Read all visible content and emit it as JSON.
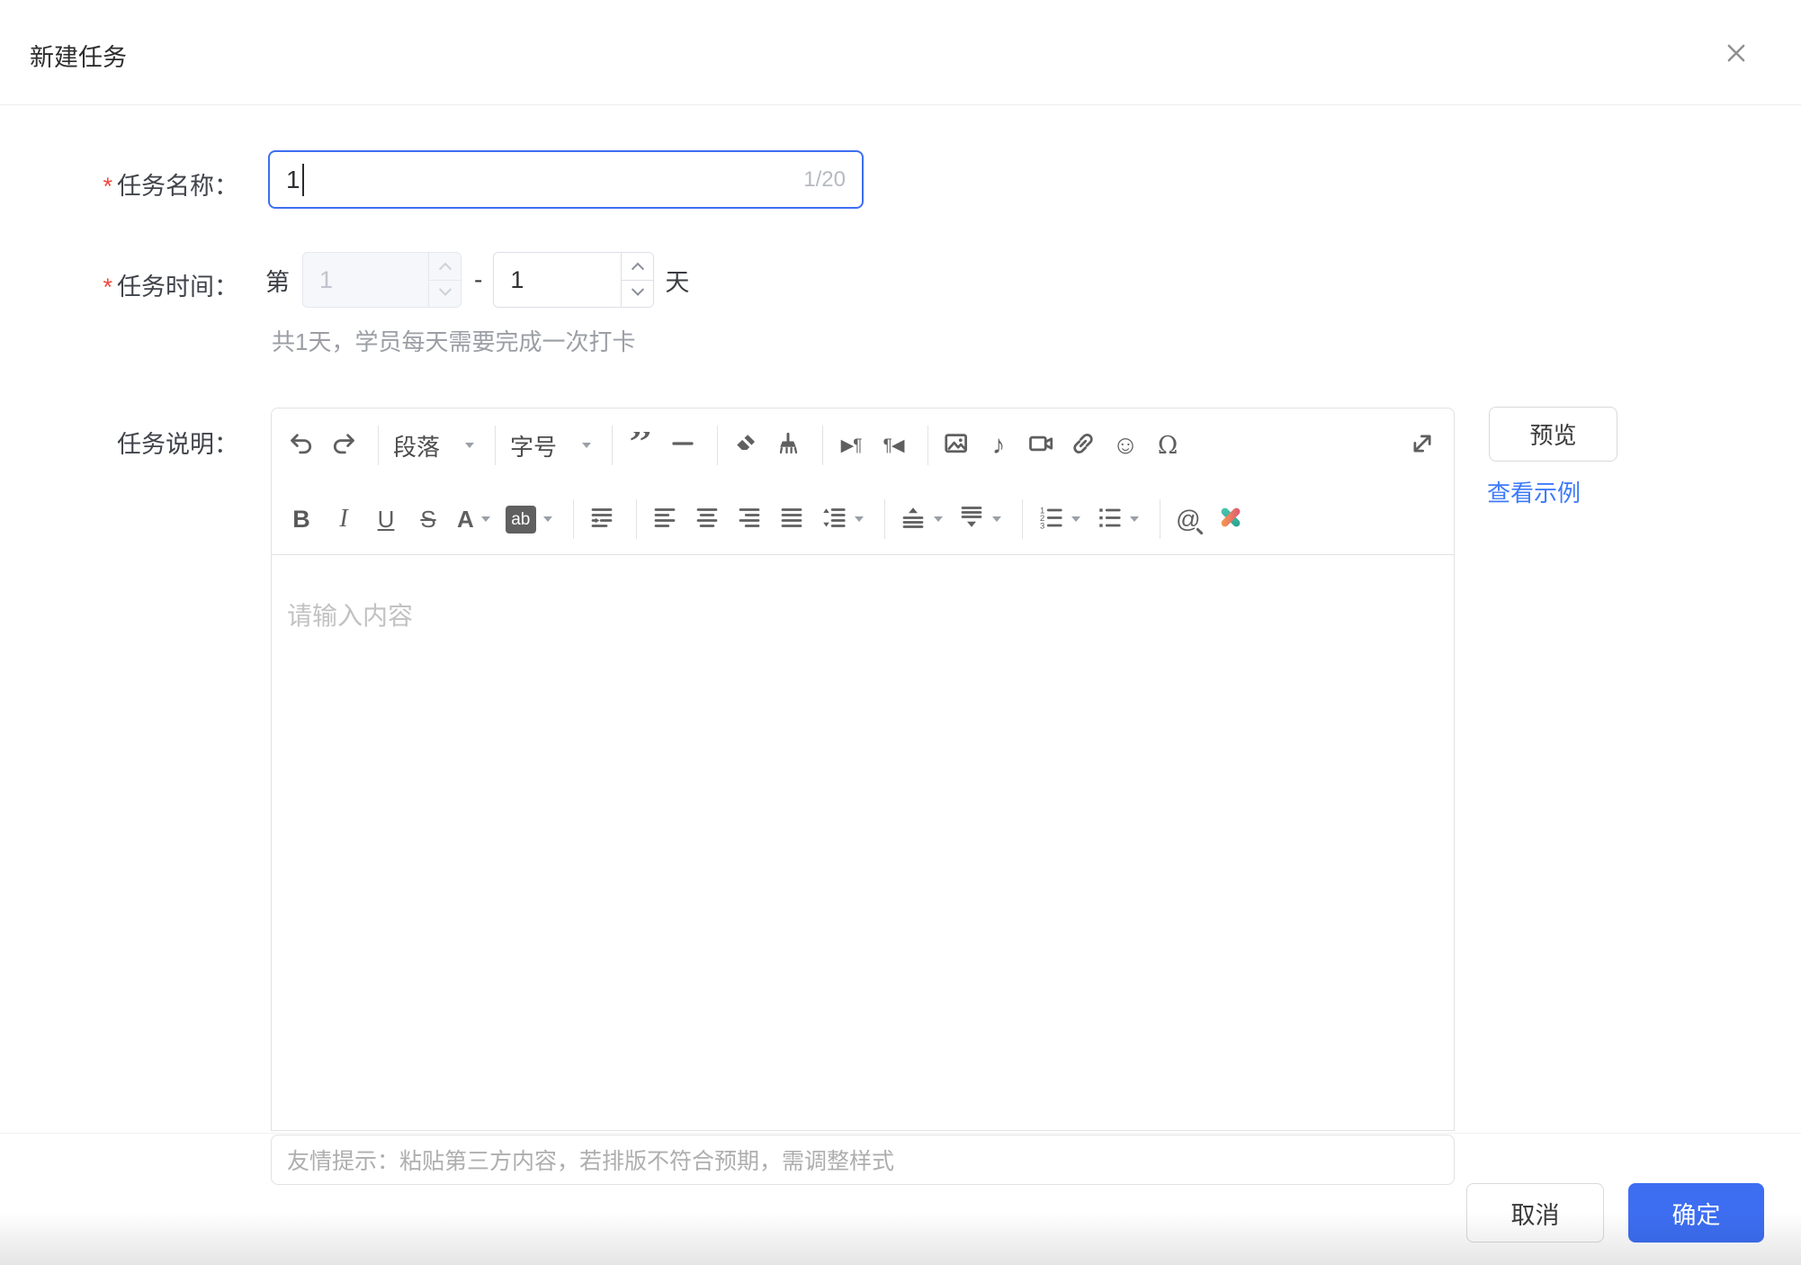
{
  "dialog": {
    "title": "新建任务",
    "close_icon": "x"
  },
  "form": {
    "task_name": {
      "required_mark": "*",
      "label": "任务名称：",
      "value": "1",
      "counter": "1/20"
    },
    "task_time": {
      "required_mark": "*",
      "label": "任务时间：",
      "prefix": "第",
      "start_value": "1",
      "start_disabled": true,
      "dash": "-",
      "end_value": "1",
      "suffix": "天",
      "hint": "共1天，学员每天需要完成一次打卡"
    },
    "task_desc": {
      "label": "任务说明："
    }
  },
  "editor": {
    "placeholder": "请输入内容",
    "paste_tip": "友情提示：粘贴第三方内容，若排版不符合预期，需调整样式",
    "toolbar_rows": [
      [
        "undo",
        "redo",
        "|",
        "paragraph-select",
        "|",
        "font-size-select",
        "|",
        "blockquote",
        "horizontal-rule",
        "|",
        "clear-format",
        "format-brush",
        "|",
        "indent",
        "outdent",
        "|",
        "image",
        "audio",
        "video",
        "link",
        "emoji",
        "special-character",
        "spacer",
        "fullscreen"
      ],
      [
        "bold",
        "italic",
        "underline",
        "strikethrough",
        "font-color",
        "highlight",
        "|",
        "first-line-indent",
        "|",
        "align-left",
        "align-center",
        "align-right",
        "align-justify",
        "line-height",
        "|",
        "margin-top",
        "margin-bottom",
        "|",
        "ordered-list",
        "unordered-list",
        "|",
        "search-at",
        "word-import"
      ]
    ],
    "tools": {
      "undo": {},
      "redo": {},
      "paragraph-select": {
        "label": "段落",
        "caret": true
      },
      "font-size-select": {
        "label": "字号",
        "caret": true
      },
      "blockquote": {
        "glyph": "”"
      },
      "horizontal-rule": {},
      "clear-format": {},
      "format-brush": {},
      "indent": {
        "glyph": "▶¶"
      },
      "outdent": {
        "glyph": "¶◀"
      },
      "image": {},
      "audio": {
        "glyph": "♪"
      },
      "video": {},
      "link": {},
      "emoji": {
        "glyph": "☺"
      },
      "special-character": {
        "glyph": "Ω"
      },
      "fullscreen": {},
      "bold": {
        "glyph": "B"
      },
      "italic": {
        "glyph": "I"
      },
      "underline": {
        "glyph": "U"
      },
      "strikethrough": {
        "glyph": "S"
      },
      "font-color": {
        "glyph": "A",
        "caret": true
      },
      "highlight": {
        "glyph": "ab",
        "caret": true
      },
      "first-line-indent": {},
      "align-left": {},
      "align-center": {},
      "align-right": {},
      "align-justify": {},
      "line-height": {
        "caret": true
      },
      "margin-top": {
        "caret": true
      },
      "margin-bottom": {
        "caret": true
      },
      "ordered-list": {
        "caret": true
      },
      "unordered-list": {
        "caret": true
      },
      "search-at": {
        "glyph": "@"
      },
      "word-import": {}
    }
  },
  "side": {
    "preview_label": "预览",
    "example_link": "查看示例"
  },
  "footer": {
    "cancel_label": "取消",
    "confirm_label": "确定"
  },
  "colors": {
    "primary": "#3D6EF2",
    "link": "#3E7BFA",
    "required": "#F0483E"
  }
}
